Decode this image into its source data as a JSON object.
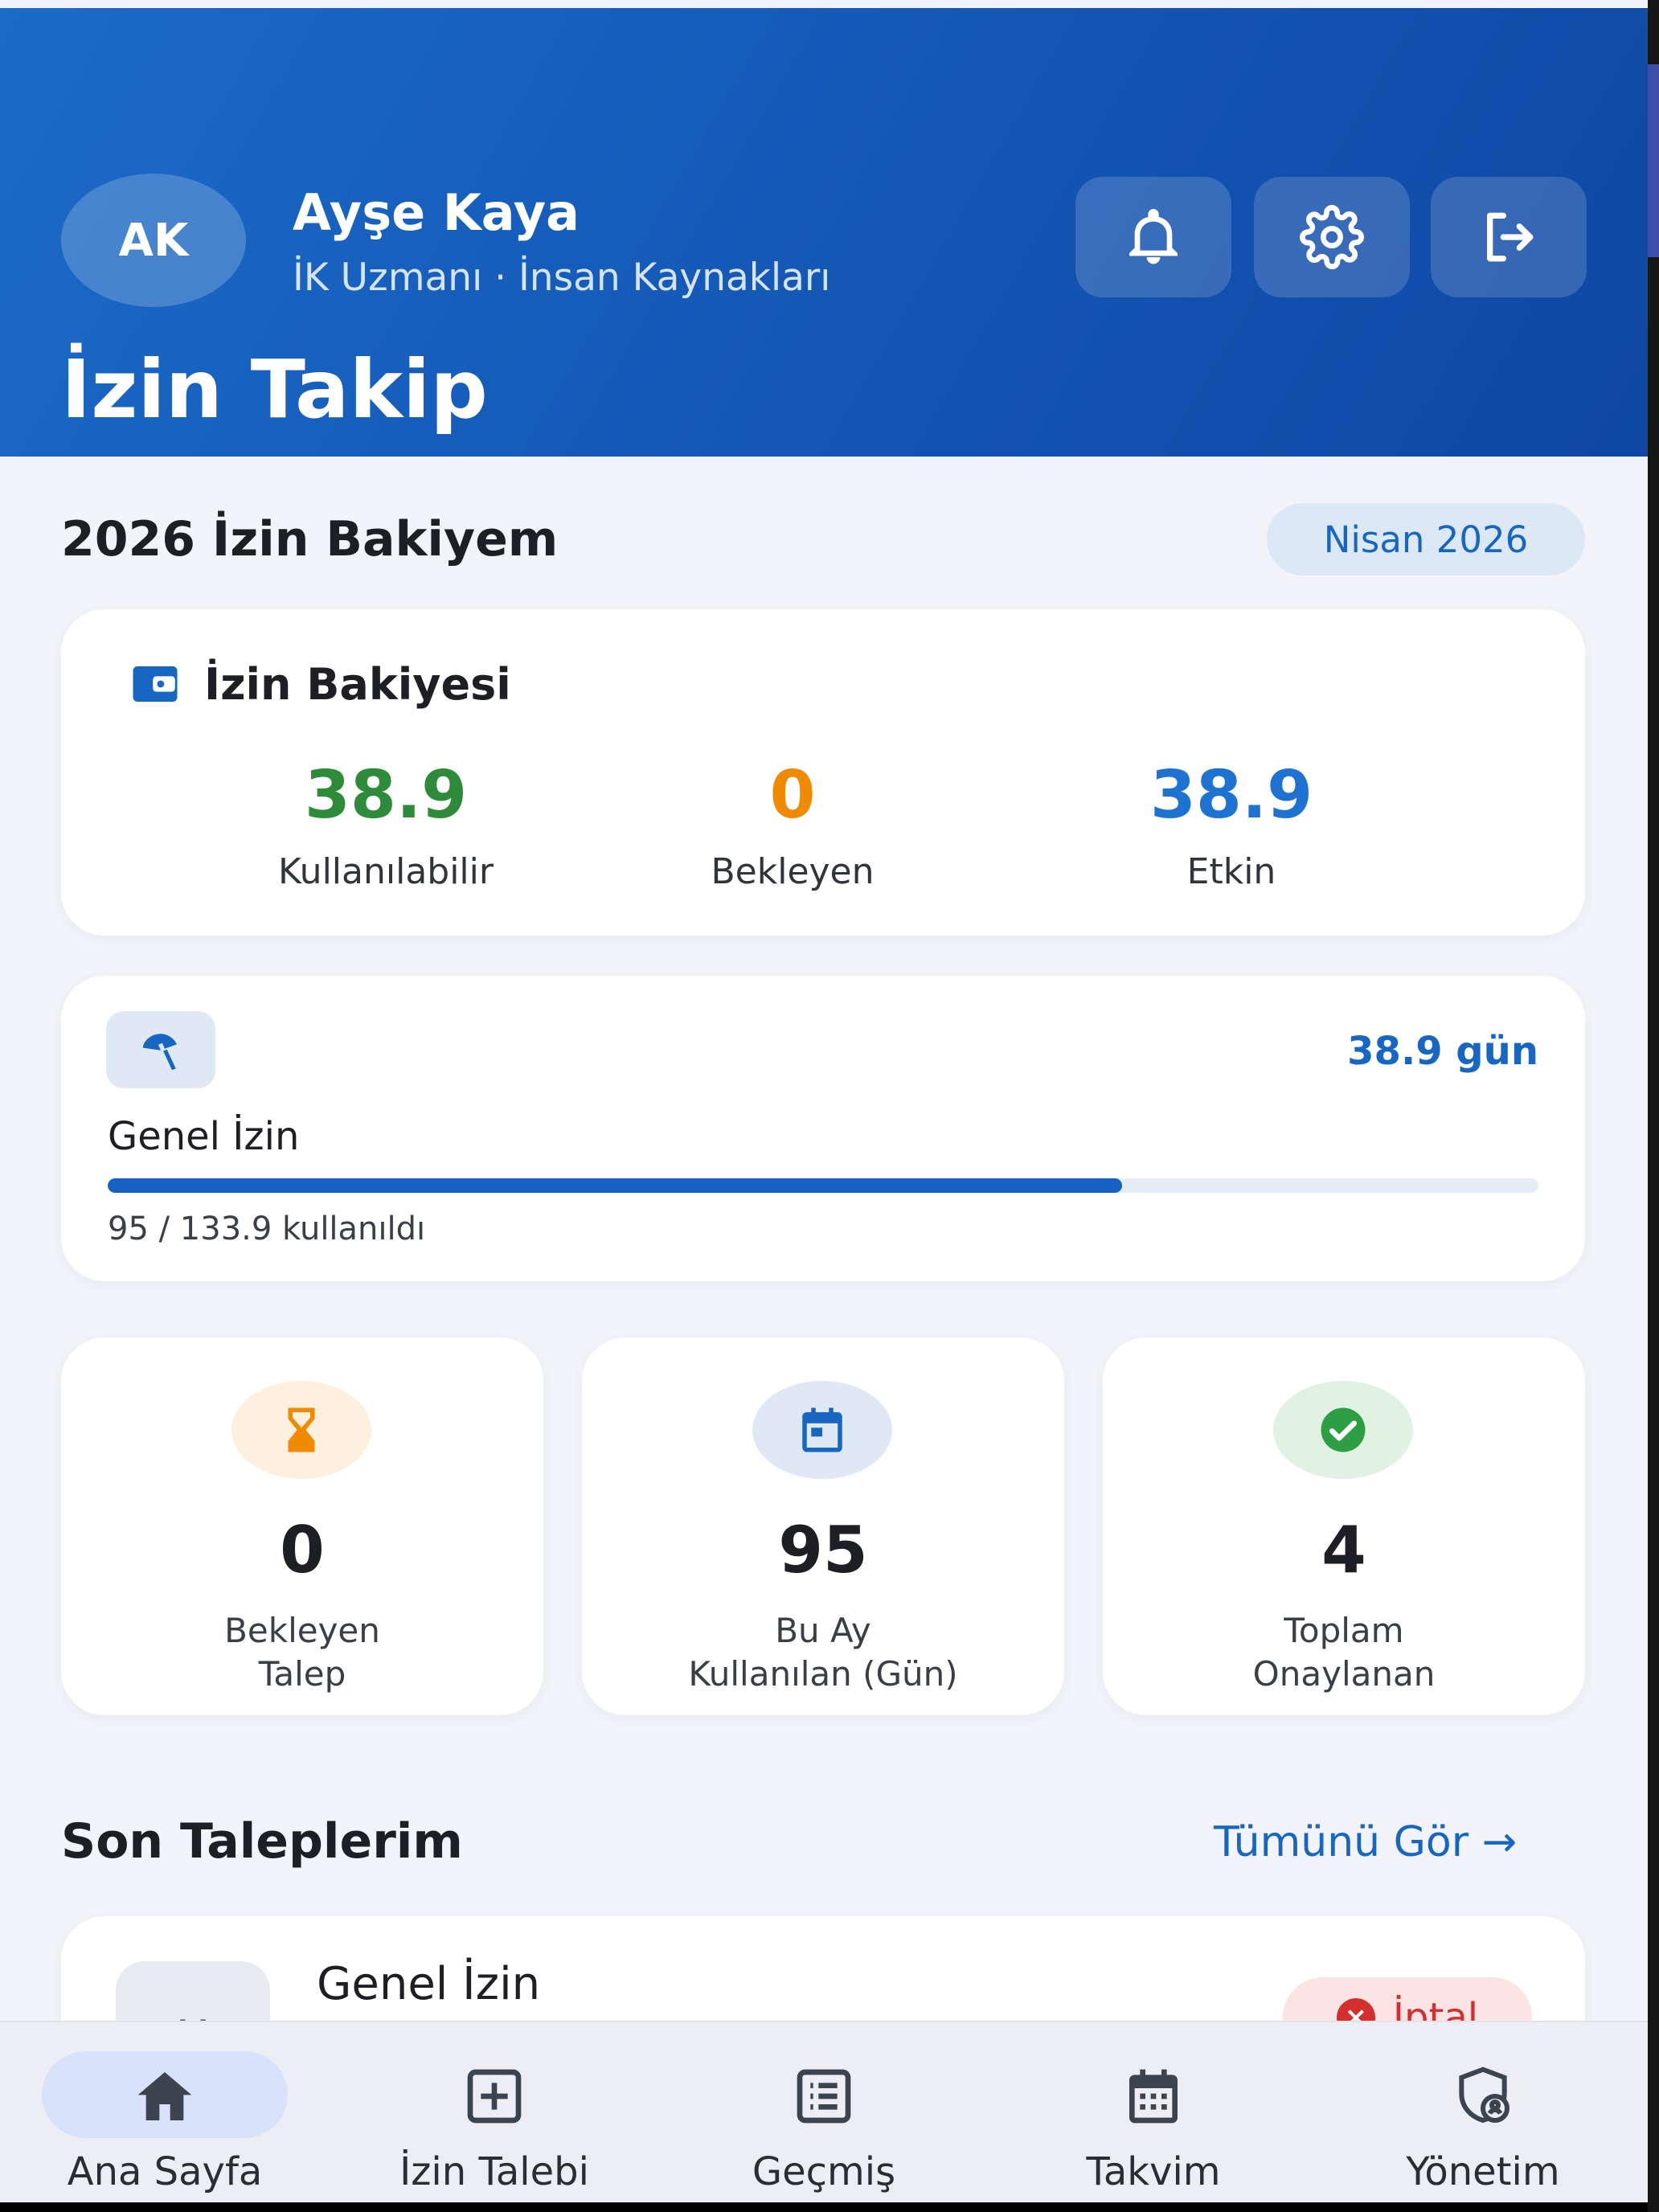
{
  "header": {
    "avatar_initials": "AK",
    "user_name": "Ayşe Kaya",
    "user_role": "İK Uzmanı · İnsan Kaynakları",
    "title": "İzin Takip",
    "icons": [
      "bell-icon",
      "gear-icon",
      "logout-icon"
    ]
  },
  "balance_section": {
    "title": "2026 İzin Bakiyem",
    "month_badge": "Nisan 2026",
    "card_title": "İzin Bakiyesi",
    "stats": [
      {
        "value": "38.9",
        "label": "Kullanılabilir",
        "color": "#2e8b3a"
      },
      {
        "value": "0",
        "label": "Bekleyen",
        "color": "#f08a00"
      },
      {
        "value": "38.9",
        "label": "Etkin",
        "color": "#1e73d2"
      }
    ]
  },
  "general_leave": {
    "name": "Genel İzin",
    "days": "38.9 gün",
    "used_text": "95 / 133.9 kullanıldı",
    "progress_fraction": 0.709
  },
  "summary_cards": [
    {
      "value": "0",
      "label_line1": "Bekleyen",
      "label_line2": "Talep",
      "icon": "hourglass-icon",
      "bg": "#fdf0de",
      "fg": "#f08a00"
    },
    {
      "value": "95",
      "label_line1": "Bu Ay",
      "label_line2": "Kullanılan (Gün)",
      "icon": "calendar-icon",
      "bg": "#dfe9f6",
      "fg": "#1766c2"
    },
    {
      "value": "4",
      "label_line1": "Toplam",
      "label_line2": "Onaylanan",
      "icon": "check-circle-icon",
      "bg": "#e1f2e3",
      "fg": "#2e9e44"
    }
  ],
  "recent": {
    "title": "Son Taleplerim",
    "see_all": "Tümünü Gör →",
    "items": [
      {
        "name": "Genel İzin",
        "status": "İptal"
      }
    ]
  },
  "bottom_nav": [
    {
      "label": "Ana Sayfa",
      "icon": "home-icon",
      "active": true
    },
    {
      "label": "İzin Talebi",
      "icon": "plus-square-icon",
      "active": false
    },
    {
      "label": "Geçmiş",
      "icon": "list-icon",
      "active": false
    },
    {
      "label": "Takvim",
      "icon": "calendar-grid-icon",
      "active": false
    },
    {
      "label": "Yönetim",
      "icon": "shield-user-icon",
      "active": false
    }
  ]
}
